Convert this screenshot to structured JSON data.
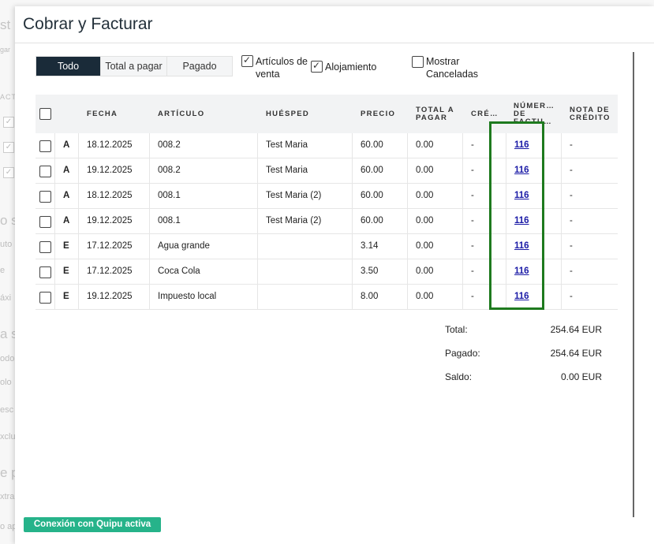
{
  "background": {
    "fragments": [
      "st",
      "gar",
      "ACTI",
      "o se",
      "uto",
      "e",
      "áxi",
      "a se",
      "odo",
      "olo",
      "esc",
      "xclu",
      "e p",
      "xtra",
      "o ap"
    ]
  },
  "modal": {
    "title": "Cobrar y Facturar"
  },
  "filters": {
    "tabs": [
      {
        "label": "Todo",
        "active": true
      },
      {
        "label": "Total a pagar",
        "active": false
      },
      {
        "label": "Pagado",
        "active": false
      }
    ],
    "checkboxes": [
      {
        "label": "Artículos de venta",
        "checked": true
      },
      {
        "label": "Alojamiento",
        "checked": true
      },
      {
        "label": "Mostrar Canceladas",
        "checked": false
      }
    ]
  },
  "table": {
    "headers": {
      "fecha": "FECHA",
      "articulo": "ARTÍCULO",
      "huesped": "HUÉSPED",
      "precio": "PRECIO",
      "total_a_pagar": "TOTAL A PAGAR",
      "credito": "CRÉ…",
      "numero_factura": "NÚMER… DE FACTU…",
      "nota_credito": "NOTA DE CRÉDITO"
    },
    "rows": [
      {
        "type": "A",
        "fecha": "18.12.2025",
        "articulo": "008.2",
        "huesped": "Test Maria",
        "precio": "60.00",
        "total": "0.00",
        "credito": "-",
        "factura": "116",
        "nota": "-"
      },
      {
        "type": "A",
        "fecha": "19.12.2025",
        "articulo": "008.2",
        "huesped": "Test Maria",
        "precio": "60.00",
        "total": "0.00",
        "credito": "-",
        "factura": "116",
        "nota": "-"
      },
      {
        "type": "A",
        "fecha": "18.12.2025",
        "articulo": "008.1",
        "huesped": "Test Maria (2)",
        "precio": "60.00",
        "total": "0.00",
        "credito": "-",
        "factura": "116",
        "nota": "-"
      },
      {
        "type": "A",
        "fecha": "19.12.2025",
        "articulo": "008.1",
        "huesped": "Test Maria (2)",
        "precio": "60.00",
        "total": "0.00",
        "credito": "-",
        "factura": "116",
        "nota": "-"
      },
      {
        "type": "E",
        "fecha": "17.12.2025",
        "articulo": "Agua grande",
        "huesped": "",
        "precio": "3.14",
        "total": "0.00",
        "credito": "-",
        "factura": "116",
        "nota": "-"
      },
      {
        "type": "E",
        "fecha": "17.12.2025",
        "articulo": "Coca Cola",
        "huesped": "",
        "precio": "3.50",
        "total": "0.00",
        "credito": "-",
        "factura": "116",
        "nota": "-"
      },
      {
        "type": "E",
        "fecha": "19.12.2025",
        "articulo": "Impuesto local",
        "huesped": "",
        "precio": "8.00",
        "total": "0.00",
        "credito": "-",
        "factura": "116",
        "nota": "-"
      }
    ]
  },
  "totals": {
    "total_label": "Total:",
    "total_value": "254.64 EUR",
    "pagado_label": "Pagado:",
    "pagado_value": "254.64 EUR",
    "saldo_label": "Saldo:",
    "saldo_value": "0.00 EUR"
  },
  "footer": {
    "quipu_label": "Conexión con Quipu activa"
  },
  "colors": {
    "active_tab": "#1a2b39",
    "highlight": "#1e7a1e",
    "quipu": "#26b38a",
    "link": "#1a1aa6"
  }
}
